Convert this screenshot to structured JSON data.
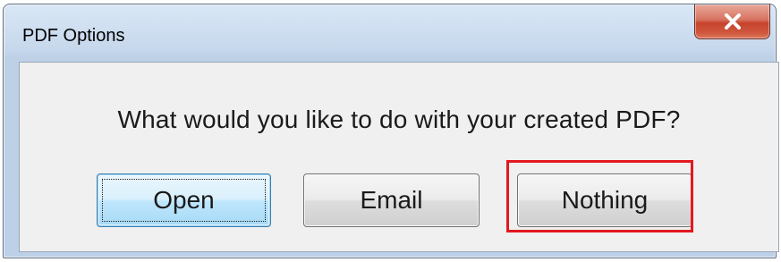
{
  "window": {
    "title": "PDF Options",
    "close_icon": "close-icon"
  },
  "dialog": {
    "prompt": "What would you like to do with your created PDF?",
    "buttons": {
      "open": "Open",
      "email": "Email",
      "nothing": "Nothing"
    },
    "focused_button": "open",
    "highlighted_button": "nothing"
  },
  "colors": {
    "highlight": "#e3181e",
    "close_button": "#c7422c",
    "focused_button": "#bee6fd"
  }
}
